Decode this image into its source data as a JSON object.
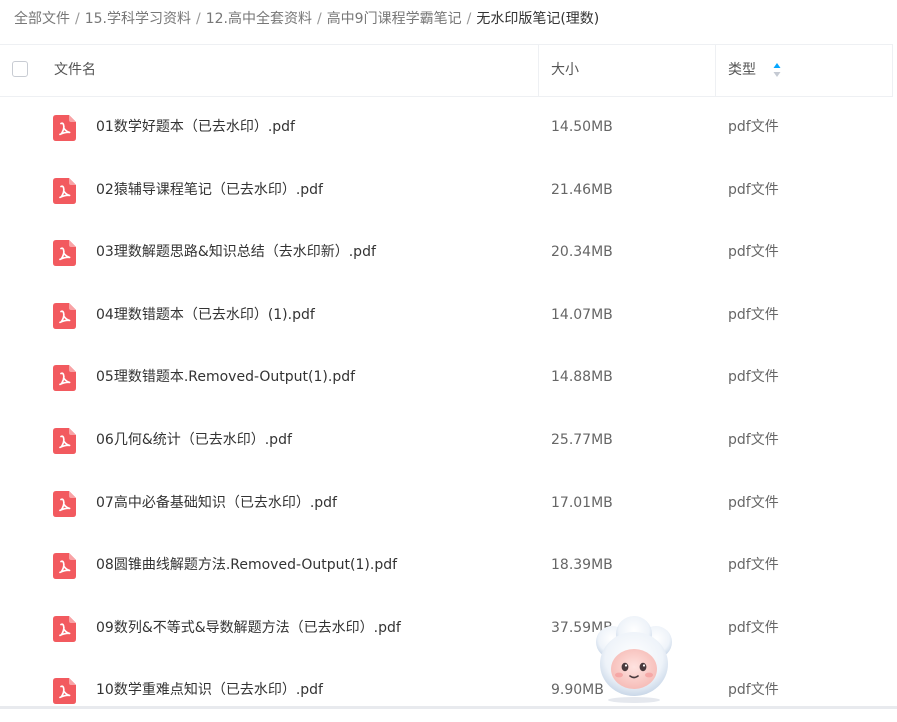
{
  "breadcrumb": {
    "items": [
      "全部文件",
      "15.学科学习资料",
      "12.高中全套资料",
      "高中9门课程学霸笔记"
    ],
    "separator": "/",
    "current": "无水印版笔记(理数)"
  },
  "table": {
    "headers": {
      "name": "文件名",
      "size": "大小",
      "type": "类型"
    },
    "rows": [
      {
        "name": "01数学好题本（已去水印）.pdf",
        "size": "14.50MB",
        "type": "pdf文件"
      },
      {
        "name": "02猿辅导课程笔记（已去水印）.pdf",
        "size": "21.46MB",
        "type": "pdf文件"
      },
      {
        "name": "03理数解题思路&知识总结（去水印新）.pdf",
        "size": "20.34MB",
        "type": "pdf文件"
      },
      {
        "name": "04理数错题本（已去水印）(1).pdf",
        "size": "14.07MB",
        "type": "pdf文件"
      },
      {
        "name": "05理数错题本.Removed-Output(1).pdf",
        "size": "14.88MB",
        "type": "pdf文件"
      },
      {
        "name": "06几何&统计（已去水印）.pdf",
        "size": "25.77MB",
        "type": "pdf文件"
      },
      {
        "name": "07高中必备基础知识（已去水印）.pdf",
        "size": "17.01MB",
        "type": "pdf文件"
      },
      {
        "name": "08圆锥曲线解题方法.Removed-Output(1).pdf",
        "size": "18.39MB",
        "type": "pdf文件"
      },
      {
        "name": "09数列&不等式&导数解题方法（已去水印）.pdf",
        "size": "37.59MB",
        "type": "pdf文件"
      },
      {
        "name": "10数学重难点知识（已去水印）.pdf",
        "size": "9.90MB",
        "type": "pdf文件"
      }
    ]
  },
  "icons": {
    "file": "pdf-file-icon",
    "sort": "sort-icon",
    "assistant": "assistant-mascot-icon"
  },
  "colors": {
    "pdf_icon": "#f25a5f",
    "sort_active": "#06a7ff",
    "sort_inactive": "#c5cad3"
  }
}
